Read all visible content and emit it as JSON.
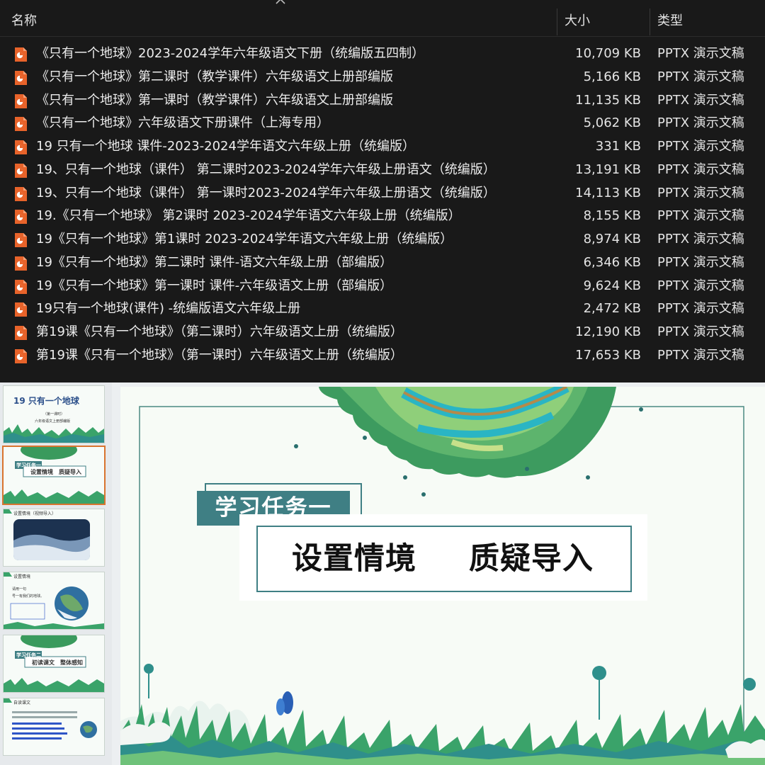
{
  "explorer": {
    "columns": {
      "name": "名称",
      "size": "大小",
      "type": "类型"
    },
    "files": [
      {
        "name": "《只有一个地球》2023-2024学年六年级语文下册（统编版五四制）",
        "size": "10,709 KB",
        "type": "PPTX 演示文稿"
      },
      {
        "name": "《只有一个地球》第二课时（教学课件）六年级语文上册部编版",
        "size": "5,166 KB",
        "type": "PPTX 演示文稿"
      },
      {
        "name": "《只有一个地球》第一课时（教学课件）六年级语文上册部编版",
        "size": "11,135 KB",
        "type": "PPTX 演示文稿"
      },
      {
        "name": "《只有一个地球》六年级语文下册课件（上海专用）",
        "size": "5,062 KB",
        "type": "PPTX 演示文稿"
      },
      {
        "name": "19 只有一个地球 课件-2023-2024学年语文六年级上册（统编版）",
        "size": "331 KB",
        "type": "PPTX 演示文稿"
      },
      {
        "name": "19、只有一个地球（课件） 第二课时2023-2024学年六年级上册语文（统编版）",
        "size": "13,191 KB",
        "type": "PPTX 演示文稿"
      },
      {
        "name": "19、只有一个地球（课件） 第一课时2023-2024学年六年级上册语文（统编版）",
        "size": "14,113 KB",
        "type": "PPTX 演示文稿"
      },
      {
        "name": "19.《只有一个地球》 第2课时 2023-2024学年语文六年级上册（统编版）",
        "size": "8,155 KB",
        "type": "PPTX 演示文稿"
      },
      {
        "name": "19《只有一个地球》第1课时 2023-2024学年语文六年级上册（统编版）",
        "size": "8,974 KB",
        "type": "PPTX 演示文稿"
      },
      {
        "name": "19《只有一个地球》第二课时 课件-语文六年级上册（部编版）",
        "size": "6,346 KB",
        "type": "PPTX 演示文稿"
      },
      {
        "name": "19《只有一个地球》第一课时 课件-六年级语文上册（部编版）",
        "size": "9,624 KB",
        "type": "PPTX 演示文稿"
      },
      {
        "name": "19只有一个地球(课件) -统编版语文六年级上册",
        "size": "2,472 KB",
        "type": "PPTX 演示文稿"
      },
      {
        "name": "第19课《只有一个地球》（第二课时）六年级语文上册（统编版）",
        "size": "12,190 KB",
        "type": "PPTX 演示文稿"
      },
      {
        "name": "第19课《只有一个地球》（第一课时）六年级语文上册（统编版）",
        "size": "17,653 KB",
        "type": "PPTX 演示文稿"
      }
    ]
  },
  "thumbnails": {
    "t1_title": "19 只有一个地球",
    "t1_sub1": "（第一课时）",
    "t1_sub2": "六年级语文上册部编版",
    "t2_task": "学习任务一",
    "t2_title": "设置情境　质疑导入",
    "t3_header": "设置情境（视频导入）",
    "t4_header": "设置情境",
    "t4_line1": "请用一句",
    "t4_line2": "号一有我们的地球。",
    "t5_task": "学习任务二",
    "t5_title": "初读课文　整体感知",
    "t6_header": "自读课文"
  },
  "slide": {
    "task_label": "学习任务一",
    "title_part1": "设置情境",
    "title_part2": "质疑导入"
  },
  "colors": {
    "explorer_bg": "#191919",
    "pptx_icon": "#e8632a",
    "teal": "#3f7f84",
    "selected_border": "#d9742f"
  },
  "icons": {
    "file": "pptx-file-icon",
    "sort": "sort-ascending-icon"
  }
}
